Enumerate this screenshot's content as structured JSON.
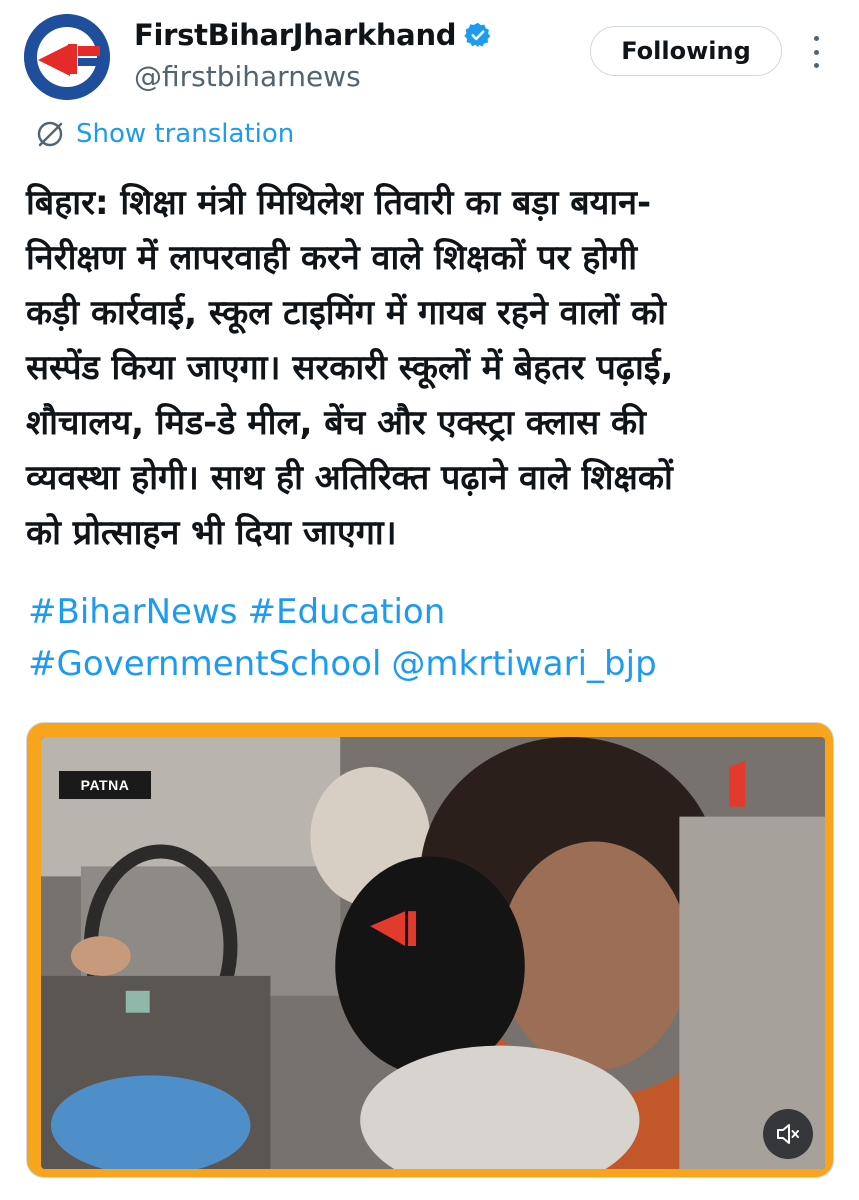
{
  "account": {
    "display_name": "FirstBiharJharkhand",
    "handle": "@firstbiharnews",
    "verified": true,
    "follow_state": "Following"
  },
  "translation": {
    "label": "Show translation"
  },
  "tweet": {
    "lines": [
      "बिहार: शिक्षा मंत्री मिथिलेश तिवारी का बड़ा बयान-",
      "निरीक्षण में लापरवाही करने वाले शिक्षकों पर होगी",
      "कड़ी कार्रवाई, स्कूल टाइमिंग में गायब रहने वालों को",
      "सस्पेंड किया जाएगा। सरकारी स्कूलों में बेहतर पढ़ाई,",
      "शौचालय, मिड-डे मील, बेंच और एक्स्ट्रा क्लास की",
      "व्यवस्था होगी। साथ ही अतिरिक्त पढ़ाने वाले शिक्षकों",
      "को प्रोत्साहन भी दिया जाएगा।"
    ],
    "hashtags": [
      "#BiharNews",
      "#Education",
      "#GovernmentSchool"
    ],
    "mention": "@mkrtiwari_bjp"
  },
  "media": {
    "location_label": "PATNA",
    "muted": true
  },
  "colors": {
    "accent": "#1d9bf0",
    "text": "#0f1419",
    "secondary": "#536471",
    "frame_border": "#f7a51c"
  }
}
